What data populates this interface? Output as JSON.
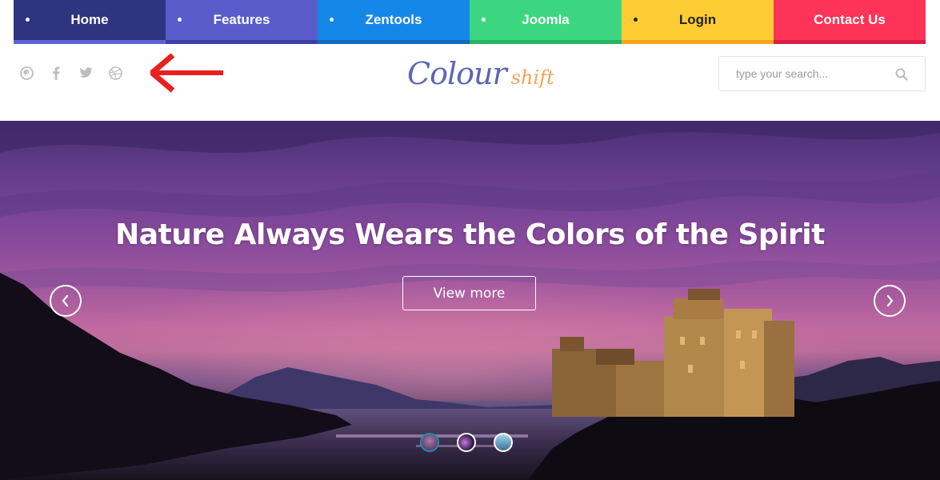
{
  "nav": {
    "items": [
      {
        "label": "Home",
        "color": "#2e3480",
        "bar": "#5b64d0",
        "text": "#ffffff"
      },
      {
        "label": "Features",
        "color": "#5a5ccc",
        "bar": "#3c3fa6",
        "text": "#ffffff"
      },
      {
        "label": "Zentools",
        "color": "#1587e8",
        "bar": "#0f6cc0",
        "text": "#ffffff"
      },
      {
        "label": "Joomla",
        "color": "#3dd680",
        "bar": "#27b463",
        "text": "#ffffff"
      },
      {
        "label": "Login",
        "color": "#fecd33",
        "bar": "#f0a81a",
        "text": "#222222"
      },
      {
        "label": "Contact Us",
        "color": "#fd3357",
        "bar": "#d81e44",
        "text": "#ffffff"
      }
    ]
  },
  "social": {
    "icons": [
      "pinterest-icon",
      "facebook-icon",
      "twitter-icon",
      "dribbble-icon"
    ],
    "icon_color": "#bdbdbd",
    "annotation_color": "#e8201e"
  },
  "logo": {
    "main": "Colour",
    "sub": "shift",
    "main_color": "#5a66b4",
    "sub_color": "#f2a35c"
  },
  "search": {
    "placeholder": "type your search...",
    "value": "",
    "icon": "search-icon"
  },
  "hero": {
    "title": "Nature Always Wears the Colors of the Spirit",
    "button_label": "View more",
    "prev_icon": "chevron-left-icon",
    "next_icon": "chevron-right-icon",
    "slides": 3,
    "active_slide": 1
  }
}
